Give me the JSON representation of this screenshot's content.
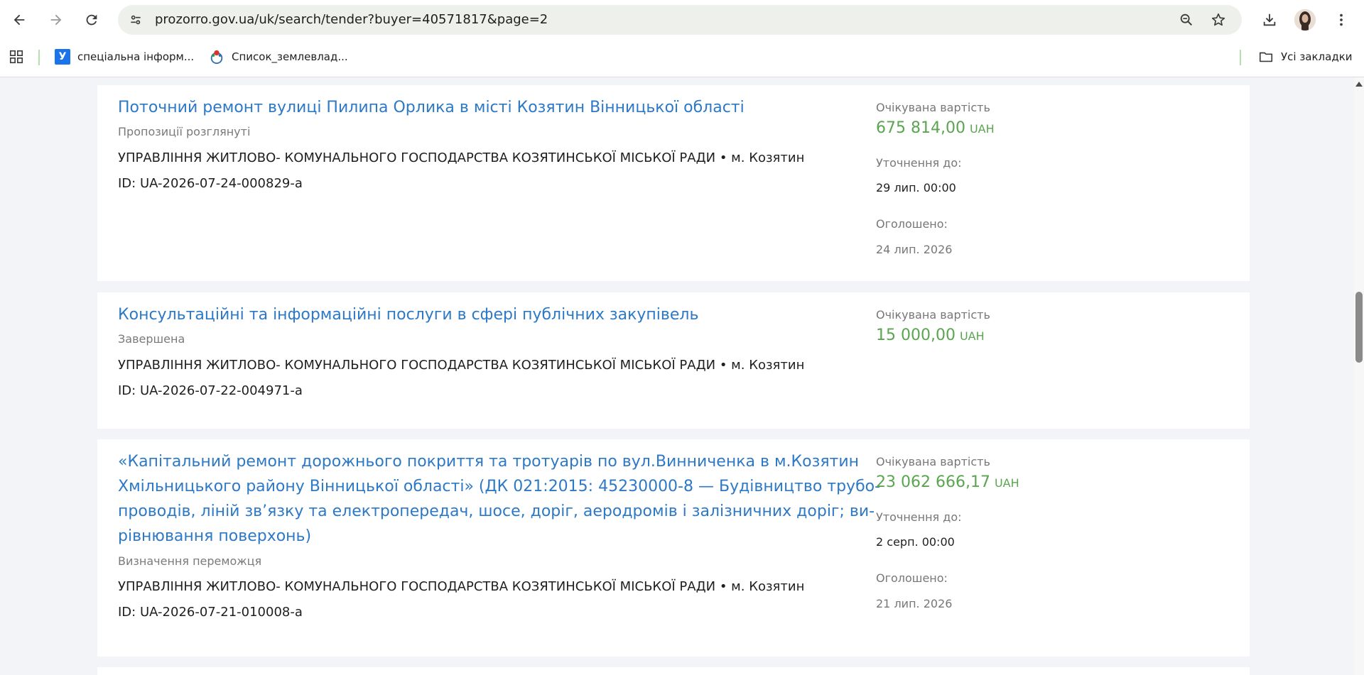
{
  "browser": {
    "url": "prozorro.gov.ua/uk/search/tender?buyer=40571817&page=2",
    "bookmarks": [
      {
        "label": "спеціальна інформ...",
        "icon": "u-badge-icon"
      },
      {
        "label": "Список_землевлад...",
        "icon": "wiki-icon"
      }
    ],
    "all_bookmarks_label": "Усі закладки"
  },
  "tenders": [
    {
      "title": "Поточний ремонт вулиці Пилипа Орлика в місті Козятин Вінницької області",
      "status": "Пропозиції розглянуті",
      "buyer": "УПРАВЛІННЯ ЖИТЛОВО- КОМУНАЛЬНОГО ГОСПОДАРСТВА КОЗЯТИНСЬКОЇ МІСЬКОЇ РАДИ • м. Козятин",
      "id": "ID: UA-2026-07-24-000829-a",
      "value_label": "Очікувана вартість",
      "value": "675 814,00",
      "currency": "UAH",
      "clarify_label": "Уточнення до:",
      "clarify_date": "29 лип. 00:00",
      "announced_label": "Оголошено:",
      "announced_date": "24 лип. 2026"
    },
    {
      "title": "Консультаційні та інформаційні послуги в сфері публічних закупівель",
      "status": "Завершена",
      "buyer": "УПРАВЛІННЯ ЖИТЛОВО- КОМУНАЛЬНОГО ГОСПОДАРСТВА КОЗЯТИНСЬКОЇ МІСЬКОЇ РАДИ • м. Козятин",
      "id": "ID: UA-2026-07-22-004971-a",
      "value_label": "Очікувана вартість",
      "value": "15 000,00",
      "currency": "UAH"
    },
    {
      "title_lines": [
        "«Капітальний ремонт дорожнього покриття та тротуарів по вул.Винниченка в м.Козятин",
        "Хмільницького району Вінницької області» (ДК 021:2015: 45230000-8 — Будівництво трубо-",
        "проводів, ліній зв’язку та електропередач, шосе, доріг, аеродромів і залізничних доріг; ви-",
        "рівнювання поверхонь)"
      ],
      "status": "Визначення переможця",
      "buyer": "УПРАВЛІННЯ ЖИТЛОВО- КОМУНАЛЬНОГО ГОСПОДАРСТВА КОЗЯТИНСЬКОЇ МІСЬКОЇ РАДИ • м. Козятин",
      "id": "ID: UA-2026-07-21-010008-a",
      "value_label": "Очікувана вартість",
      "value": "23 062 666,17",
      "currency": "UAH",
      "clarify_label": "Уточнення до:",
      "clarify_date": "2 серп. 00:00",
      "announced_label": "Оголошено:",
      "announced_date": "21 лип. 2026"
    }
  ],
  "colors": {
    "link": "#2d79c6",
    "amount": "#5aa54f",
    "page_bg": "#f2f4f7"
  }
}
